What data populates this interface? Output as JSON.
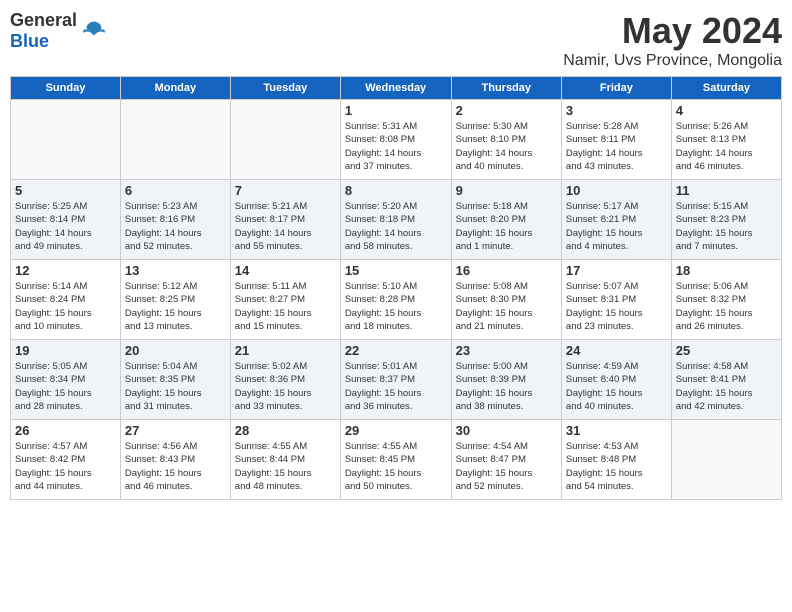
{
  "logo": {
    "general": "General",
    "blue": "Blue"
  },
  "title": "May 2024",
  "location": "Namir, Uvs Province, Mongolia",
  "days_of_week": [
    "Sunday",
    "Monday",
    "Tuesday",
    "Wednesday",
    "Thursday",
    "Friday",
    "Saturday"
  ],
  "weeks": [
    [
      {
        "day": "",
        "info": ""
      },
      {
        "day": "",
        "info": ""
      },
      {
        "day": "",
        "info": ""
      },
      {
        "day": "1",
        "info": "Sunrise: 5:31 AM\nSunset: 8:08 PM\nDaylight: 14 hours\nand 37 minutes."
      },
      {
        "day": "2",
        "info": "Sunrise: 5:30 AM\nSunset: 8:10 PM\nDaylight: 14 hours\nand 40 minutes."
      },
      {
        "day": "3",
        "info": "Sunrise: 5:28 AM\nSunset: 8:11 PM\nDaylight: 14 hours\nand 43 minutes."
      },
      {
        "day": "4",
        "info": "Sunrise: 5:26 AM\nSunset: 8:13 PM\nDaylight: 14 hours\nand 46 minutes."
      }
    ],
    [
      {
        "day": "5",
        "info": "Sunrise: 5:25 AM\nSunset: 8:14 PM\nDaylight: 14 hours\nand 49 minutes."
      },
      {
        "day": "6",
        "info": "Sunrise: 5:23 AM\nSunset: 8:16 PM\nDaylight: 14 hours\nand 52 minutes."
      },
      {
        "day": "7",
        "info": "Sunrise: 5:21 AM\nSunset: 8:17 PM\nDaylight: 14 hours\nand 55 minutes."
      },
      {
        "day": "8",
        "info": "Sunrise: 5:20 AM\nSunset: 8:18 PM\nDaylight: 14 hours\nand 58 minutes."
      },
      {
        "day": "9",
        "info": "Sunrise: 5:18 AM\nSunset: 8:20 PM\nDaylight: 15 hours\nand 1 minute."
      },
      {
        "day": "10",
        "info": "Sunrise: 5:17 AM\nSunset: 8:21 PM\nDaylight: 15 hours\nand 4 minutes."
      },
      {
        "day": "11",
        "info": "Sunrise: 5:15 AM\nSunset: 8:23 PM\nDaylight: 15 hours\nand 7 minutes."
      }
    ],
    [
      {
        "day": "12",
        "info": "Sunrise: 5:14 AM\nSunset: 8:24 PM\nDaylight: 15 hours\nand 10 minutes."
      },
      {
        "day": "13",
        "info": "Sunrise: 5:12 AM\nSunset: 8:25 PM\nDaylight: 15 hours\nand 13 minutes."
      },
      {
        "day": "14",
        "info": "Sunrise: 5:11 AM\nSunset: 8:27 PM\nDaylight: 15 hours\nand 15 minutes."
      },
      {
        "day": "15",
        "info": "Sunrise: 5:10 AM\nSunset: 8:28 PM\nDaylight: 15 hours\nand 18 minutes."
      },
      {
        "day": "16",
        "info": "Sunrise: 5:08 AM\nSunset: 8:30 PM\nDaylight: 15 hours\nand 21 minutes."
      },
      {
        "day": "17",
        "info": "Sunrise: 5:07 AM\nSunset: 8:31 PM\nDaylight: 15 hours\nand 23 minutes."
      },
      {
        "day": "18",
        "info": "Sunrise: 5:06 AM\nSunset: 8:32 PM\nDaylight: 15 hours\nand 26 minutes."
      }
    ],
    [
      {
        "day": "19",
        "info": "Sunrise: 5:05 AM\nSunset: 8:34 PM\nDaylight: 15 hours\nand 28 minutes."
      },
      {
        "day": "20",
        "info": "Sunrise: 5:04 AM\nSunset: 8:35 PM\nDaylight: 15 hours\nand 31 minutes."
      },
      {
        "day": "21",
        "info": "Sunrise: 5:02 AM\nSunset: 8:36 PM\nDaylight: 15 hours\nand 33 minutes."
      },
      {
        "day": "22",
        "info": "Sunrise: 5:01 AM\nSunset: 8:37 PM\nDaylight: 15 hours\nand 36 minutes."
      },
      {
        "day": "23",
        "info": "Sunrise: 5:00 AM\nSunset: 8:39 PM\nDaylight: 15 hours\nand 38 minutes."
      },
      {
        "day": "24",
        "info": "Sunrise: 4:59 AM\nSunset: 8:40 PM\nDaylight: 15 hours\nand 40 minutes."
      },
      {
        "day": "25",
        "info": "Sunrise: 4:58 AM\nSunset: 8:41 PM\nDaylight: 15 hours\nand 42 minutes."
      }
    ],
    [
      {
        "day": "26",
        "info": "Sunrise: 4:57 AM\nSunset: 8:42 PM\nDaylight: 15 hours\nand 44 minutes."
      },
      {
        "day": "27",
        "info": "Sunrise: 4:56 AM\nSunset: 8:43 PM\nDaylight: 15 hours\nand 46 minutes."
      },
      {
        "day": "28",
        "info": "Sunrise: 4:55 AM\nSunset: 8:44 PM\nDaylight: 15 hours\nand 48 minutes."
      },
      {
        "day": "29",
        "info": "Sunrise: 4:55 AM\nSunset: 8:45 PM\nDaylight: 15 hours\nand 50 minutes."
      },
      {
        "day": "30",
        "info": "Sunrise: 4:54 AM\nSunset: 8:47 PM\nDaylight: 15 hours\nand 52 minutes."
      },
      {
        "day": "31",
        "info": "Sunrise: 4:53 AM\nSunset: 8:48 PM\nDaylight: 15 hours\nand 54 minutes."
      },
      {
        "day": "",
        "info": ""
      }
    ]
  ]
}
